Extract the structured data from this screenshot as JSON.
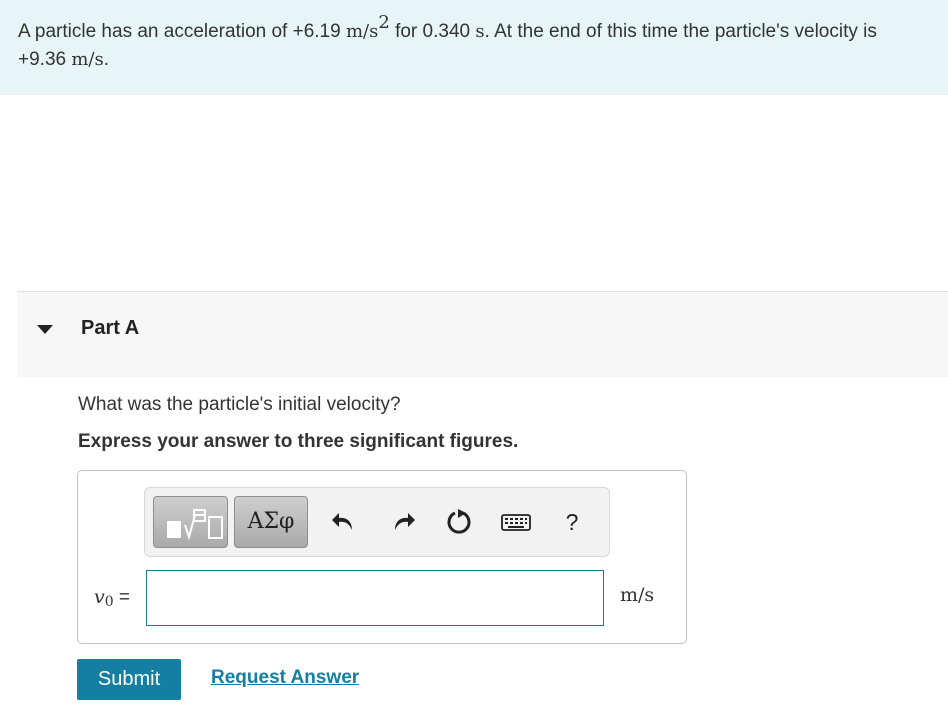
{
  "problem": {
    "text_1": "A particle has an acceleration of +6.19 ",
    "unit_accel": "m/s",
    "unit_accel_exp": "2",
    "text_2": " for 0.340 ",
    "unit_time": "s",
    "text_3": ". At the end of this time the particle's velocity is",
    "text_4": "+9.36 ",
    "unit_vel": "m/s",
    "text_5": "."
  },
  "part": {
    "title": "Part A",
    "question": "What was the particle's initial velocity?",
    "instruction": "Express your answer to three significant figures."
  },
  "toolbar": {
    "templates_icon": "templates-icon",
    "greek_label": "ΑΣφ",
    "undo_icon": "undo-icon",
    "redo_icon": "redo-icon",
    "reset_icon": "reset-icon",
    "keyboard_icon": "keyboard-icon",
    "help_label": "?"
  },
  "answer": {
    "variable": "v",
    "variable_sub": "0",
    "equals": " =",
    "value": "",
    "unit": "m/s"
  },
  "actions": {
    "submit_label": "Submit",
    "request_label": "Request Answer"
  },
  "colors": {
    "accent": "#157ea3",
    "problem_bg": "#e8f5f6",
    "part_bg": "#f7f7f7"
  }
}
